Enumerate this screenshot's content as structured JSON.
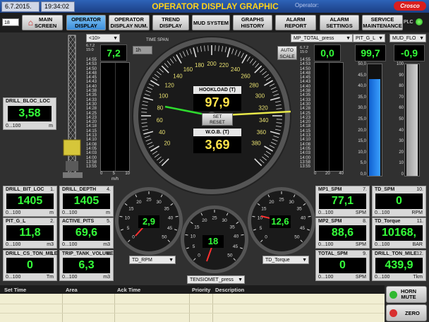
{
  "topbar": {
    "date": "6.7.2015.",
    "time": "19:34:02",
    "title": "OPERATOR DISPLAY GRAPHIC",
    "operator_label": "Operator:",
    "plc_label": "PLC",
    "screen_number": "18"
  },
  "nav": [
    {
      "label": "MAIN\nSCREEN",
      "icon": "home-icon",
      "active": false
    },
    {
      "label": "OPERATOR\nDISPLAY",
      "active": true
    },
    {
      "label": "OPERATOR\nDISPLAY NUM.",
      "active": false
    },
    {
      "label": "TREND\nDISPLAY",
      "active": false
    },
    {
      "label": "MUD SYSTEM",
      "active": false
    },
    {
      "label": "GRAPHS\nHISTORY",
      "active": false
    },
    {
      "label": "ALARM\nREPORT",
      "active": false
    },
    {
      "label": "ALARM\nSETTINGS",
      "active": false
    },
    {
      "label": "SERVICE\nMAINTENANCE",
      "active": false
    }
  ],
  "controls": {
    "trend_select": "<10>",
    "time_span_label": "TIME SPAN",
    "time_span_value": "1h",
    "auto_scale_label": "AUTO\nSCALE",
    "mp_total_select": "MP_TOTAL_press",
    "pit_select": "PIT_G_L",
    "mud_select": "MUD_FLO",
    "set_reset_label": "SET\nRESET",
    "td_rpm_select": "TD_RPM",
    "td_torque_select": "TD_Torque",
    "tensiomet_select": "TENSIOMET_press"
  },
  "strip_times": [
    "14:55",
    "14:53",
    "14:50",
    "14:48",
    "14:45",
    "14:43",
    "14:40",
    "14:38",
    "14:35",
    "14:33",
    "14:30",
    "14:28",
    "14:25",
    "14:23",
    "14:20",
    "14:18",
    "14:15",
    "14:13",
    "14:10",
    "14:08",
    "14:05",
    "14:03",
    "14:00",
    "13:58",
    "13:55"
  ],
  "strip_left": {
    "value": "7,2",
    "top_label": "6.7.2\n15:0",
    "axis": [
      "0",
      "5",
      "10"
    ],
    "unit": "m/h"
  },
  "strip_right": {
    "value": "0,0",
    "top_label": "6.7.2\n15:0",
    "axis": [
      "0",
      "20",
      "40"
    ]
  },
  "pit_bar": {
    "value": "99,7",
    "scale": [
      "50,0",
      "45,0",
      "40,0",
      "35,0",
      "30,0",
      "25,0",
      "20,0",
      "15,0",
      "10,0",
      "5,0",
      "0,0"
    ],
    "level": 0.87
  },
  "mud_bar": {
    "value": "-0,9",
    "scale": [
      "100",
      "90",
      "80",
      "70",
      "60",
      "50",
      "40",
      "30",
      "20",
      "10",
      "0"
    ],
    "level": 0.0
  },
  "hookload": {
    "label": "HOOKLOAD (T)",
    "value": "97,9",
    "wob_label": "W.O.B. (T)",
    "wob_value": "3,69",
    "ticks": [
      "20",
      "40",
      "60",
      "80",
      "100",
      "120",
      "140",
      "160",
      "180",
      "200",
      "220",
      "240",
      "260",
      "280",
      "300",
      "320",
      "340",
      "360",
      "380"
    ]
  },
  "drill_bloc": {
    "title": "DRILL_BLOC_LOC",
    "value": "3,58",
    "range": "0...100",
    "unit": "m"
  },
  "panels_left": [
    {
      "title": "DRILL_BIT_LOC",
      "num": "1.",
      "value": "1405",
      "range": "0...100",
      "unit": "m"
    },
    {
      "title": "DRILL_DEPTH",
      "num": "4.",
      "value": "1405",
      "range": "0...100",
      "unit": "m"
    },
    {
      "title": "PIT_G_L",
      "num": "2.",
      "value": "11,8",
      "range": "0...100",
      "unit": "m3"
    },
    {
      "title": "ACTIVE_PITS",
      "num": "5.",
      "value": "69,6",
      "range": "0...100",
      "unit": "m3"
    },
    {
      "title": "DRILL_CS_TON_MILE",
      "num": "3.",
      "value": "0",
      "range": "0...100",
      "unit": "Tm"
    },
    {
      "title": "TRIP_TANK_VOLUME",
      "num": "6.",
      "value": "6,3",
      "range": "0...100",
      "unit": "m3"
    }
  ],
  "panels_right": [
    {
      "title": "MP1_SPM",
      "num": "7.",
      "value": "77,1",
      "range": "0...100",
      "unit": "SPM"
    },
    {
      "title": "TD_SPM",
      "num": "10.",
      "value": "0",
      "range": "0...100",
      "unit": "RPM"
    },
    {
      "title": "MP2_SPM",
      "num": "8.",
      "value": "88,6",
      "range": "0...100",
      "unit": "SPM"
    },
    {
      "title": "TD_Torque",
      "num": "11.",
      "value": "10168,",
      "range": "0...100",
      "unit": "BAR"
    },
    {
      "title": "TOTAL_SPM",
      "num": "9.",
      "value": "0",
      "range": "0...100",
      "unit": "SPM"
    },
    {
      "title": "DRILL_TON_MILE",
      "num": "12.",
      "value": "439,9",
      "range": "0...100",
      "unit": "Tkm"
    }
  ],
  "gauges": {
    "rpm": {
      "value": "2,9",
      "ticks": [
        "0",
        "5",
        "10",
        "15",
        "20",
        "25",
        "30",
        "35",
        "40",
        "45",
        "50"
      ]
    },
    "tensiomet": {
      "value": "18",
      "ticks": [
        "0",
        "5",
        "10",
        "15",
        "20",
        "25",
        "30",
        "35",
        "40",
        "45",
        "50"
      ]
    },
    "torque": {
      "value": "12,6",
      "ticks": [
        "0",
        "5",
        "10",
        "15",
        "20",
        "25",
        "30",
        "35",
        "40",
        "45",
        "50"
      ]
    }
  },
  "alarms": {
    "columns": [
      "Set Time",
      "Area",
      "Ack Time",
      "Priority",
      "Description"
    ],
    "horn_label": "HORN\nMUTE",
    "zero_label": "ZERO"
  },
  "colors": {
    "lcd_green": "#35ff3a",
    "lcd_yellow": "#ffe34a",
    "title_yellow": "#ffd21a",
    "active_blue": "#5aa8ea"
  }
}
